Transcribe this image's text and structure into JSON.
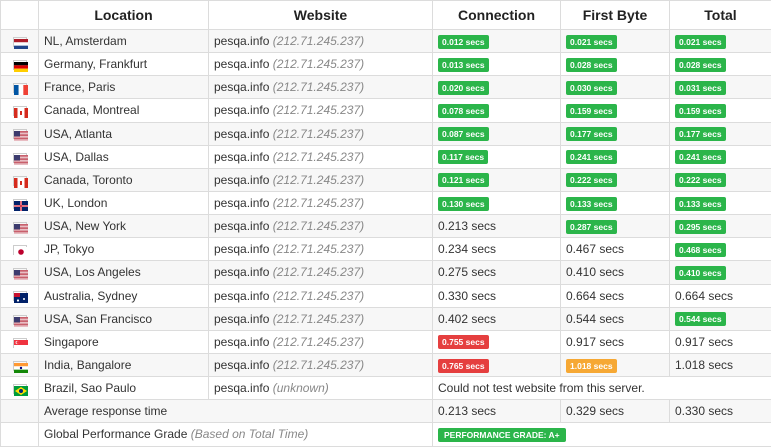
{
  "headers": {
    "location": "Location",
    "website": "Website",
    "connection": "Connection",
    "first_byte": "First Byte",
    "total": "Total"
  },
  "rows": [
    {
      "flag": "nl",
      "location": "NL, Amsterdam",
      "site": "pesqa.info",
      "ip": "(212.71.245.237)",
      "connection": "0.012 secs",
      "connection_status": "green",
      "first_byte": "0.021 secs",
      "first_byte_status": "green",
      "total": "0.021 secs",
      "total_status": "green"
    },
    {
      "flag": "de",
      "location": "Germany, Frankfurt",
      "site": "pesqa.info",
      "ip": "(212.71.245.237)",
      "connection": "0.013 secs",
      "connection_status": "green",
      "first_byte": "0.028 secs",
      "first_byte_status": "green",
      "total": "0.028 secs",
      "total_status": "green"
    },
    {
      "flag": "fr",
      "location": "France, Paris",
      "site": "pesqa.info",
      "ip": "(212.71.245.237)",
      "connection": "0.020 secs",
      "connection_status": "green",
      "first_byte": "0.030 secs",
      "first_byte_status": "green",
      "total": "0.031 secs",
      "total_status": "green"
    },
    {
      "flag": "ca",
      "location": "Canada, Montreal",
      "site": "pesqa.info",
      "ip": "(212.71.245.237)",
      "connection": "0.078 secs",
      "connection_status": "green",
      "first_byte": "0.159 secs",
      "first_byte_status": "green",
      "total": "0.159 secs",
      "total_status": "green"
    },
    {
      "flag": "us",
      "location": "USA, Atlanta",
      "site": "pesqa.info",
      "ip": "(212.71.245.237)",
      "connection": "0.087 secs",
      "connection_status": "green",
      "first_byte": "0.177 secs",
      "first_byte_status": "green",
      "total": "0.177 secs",
      "total_status": "green"
    },
    {
      "flag": "us",
      "location": "USA, Dallas",
      "site": "pesqa.info",
      "ip": "(212.71.245.237)",
      "connection": "0.117 secs",
      "connection_status": "green",
      "first_byte": "0.241 secs",
      "first_byte_status": "green",
      "total": "0.241 secs",
      "total_status": "green"
    },
    {
      "flag": "ca",
      "location": "Canada, Toronto",
      "site": "pesqa.info",
      "ip": "(212.71.245.237)",
      "connection": "0.121 secs",
      "connection_status": "green",
      "first_byte": "0.222 secs",
      "first_byte_status": "green",
      "total": "0.222 secs",
      "total_status": "green"
    },
    {
      "flag": "uk",
      "location": "UK, London",
      "site": "pesqa.info",
      "ip": "(212.71.245.237)",
      "connection": "0.130 secs",
      "connection_status": "green",
      "first_byte": "0.133 secs",
      "first_byte_status": "green",
      "total": "0.133 secs",
      "total_status": "green"
    },
    {
      "flag": "us",
      "location": "USA, New York",
      "site": "pesqa.info",
      "ip": "(212.71.245.237)",
      "connection": "0.213 secs",
      "connection_status": "plain",
      "first_byte": "0.287 secs",
      "first_byte_status": "green",
      "total": "0.295 secs",
      "total_status": "green"
    },
    {
      "flag": "jp",
      "location": "JP, Tokyo",
      "site": "pesqa.info",
      "ip": "(212.71.245.237)",
      "connection": "0.234 secs",
      "connection_status": "plain",
      "first_byte": "0.467 secs",
      "first_byte_status": "plain",
      "total": "0.468 secs",
      "total_status": "green"
    },
    {
      "flag": "us",
      "location": "USA, Los Angeles",
      "site": "pesqa.info",
      "ip": "(212.71.245.237)",
      "connection": "0.275 secs",
      "connection_status": "plain",
      "first_byte": "0.410 secs",
      "first_byte_status": "plain",
      "total": "0.410 secs",
      "total_status": "green"
    },
    {
      "flag": "au",
      "location": "Australia, Sydney",
      "site": "pesqa.info",
      "ip": "(212.71.245.237)",
      "connection": "0.330 secs",
      "connection_status": "plain",
      "first_byte": "0.664 secs",
      "first_byte_status": "plain",
      "total": "0.664 secs",
      "total_status": "plain"
    },
    {
      "flag": "us",
      "location": "USA, San Francisco",
      "site": "pesqa.info",
      "ip": "(212.71.245.237)",
      "connection": "0.402 secs",
      "connection_status": "plain",
      "first_byte": "0.544 secs",
      "first_byte_status": "plain",
      "total": "0.544 secs",
      "total_status": "green"
    },
    {
      "flag": "sg",
      "location": "Singapore",
      "site": "pesqa.info",
      "ip": "(212.71.245.237)",
      "connection": "0.755 secs",
      "connection_status": "red",
      "first_byte": "0.917 secs",
      "first_byte_status": "plain",
      "total": "0.917 secs",
      "total_status": "plain"
    },
    {
      "flag": "in",
      "location": "India, Bangalore",
      "site": "pesqa.info",
      "ip": "(212.71.245.237)",
      "connection": "0.765 secs",
      "connection_status": "red",
      "first_byte": "1.018 secs",
      "first_byte_status": "orange",
      "total": "1.018 secs",
      "total_status": "plain"
    }
  ],
  "brazil": {
    "flag": "br",
    "location": "Brazil, Sao Paulo",
    "site": "pesqa.info",
    "ip": "(unknown)",
    "message": "Could not test website from this server."
  },
  "average": {
    "label": "Average response time",
    "connection": "0.213 secs",
    "first_byte": "0.329 secs",
    "total": "0.330 secs"
  },
  "grade": {
    "label": "Global Performance Grade",
    "note": "(Based on Total Time)",
    "badge": "PERFORMANCE GRADE:  A+"
  },
  "colors": {
    "green": "#2bb54a",
    "red": "#e53f3f",
    "orange": "#f6a834"
  }
}
